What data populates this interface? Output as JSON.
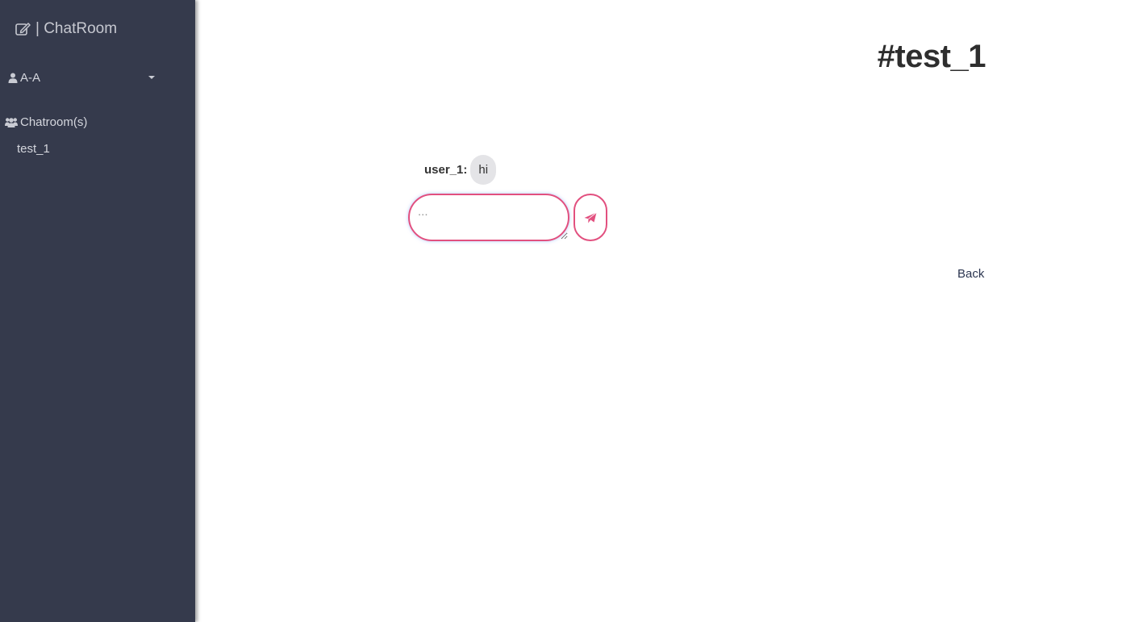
{
  "sidebar": {
    "brand": {
      "icon": "edit-icon",
      "label": "| ChatRoom"
    },
    "user_menu": {
      "icon": "user-icon",
      "label": "A-A",
      "caret_icon": "caret-down-icon"
    },
    "rooms": {
      "icon": "users-icon",
      "header": "Chatroom(s)",
      "items": [
        {
          "label": "test_1"
        }
      ]
    }
  },
  "main": {
    "room_title": "#test_1",
    "messages": [
      {
        "user": "user_1:",
        "text": "hi"
      }
    ],
    "composer": {
      "placeholder": "...",
      "value": "",
      "send_icon": "paper-plane-icon",
      "accent_color": "#e2507f"
    },
    "back_label": "Back"
  },
  "colors": {
    "sidebar_bg": "#353a4c",
    "bubble_bg": "#e4e4e7",
    "accent": "#e2507f"
  }
}
